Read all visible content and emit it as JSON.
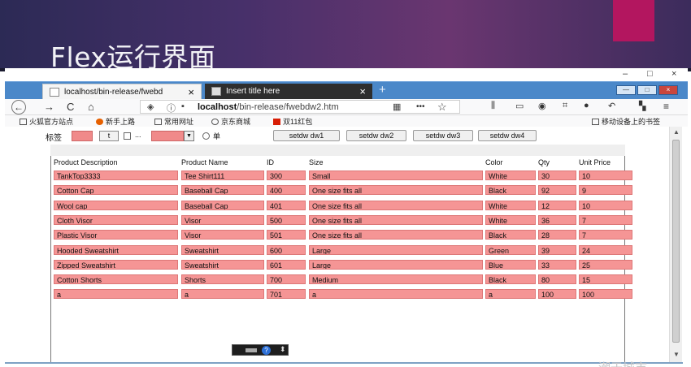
{
  "slide": {
    "title": "Flex运行界面",
    "accent_color": "#b3165f"
  },
  "window": {
    "minimize": "–",
    "maximize": "□",
    "close": "×"
  },
  "tabs": [
    {
      "label": "localhost/bin-release/fwebd",
      "close": "×"
    },
    {
      "label": "Insert title here",
      "close": "×"
    }
  ],
  "newtab": "+",
  "nav": {
    "back": "←",
    "forward": "→",
    "reload": "C",
    "home": "⌂",
    "url_host": "localhost",
    "url_path": "/bin-release/fwebdw2.htm",
    "more": "•••",
    "star": "☆"
  },
  "bookmarks": {
    "items": [
      "火狐官方站点",
      "新手上路",
      "常用网址",
      "京东商城",
      "双11红包"
    ],
    "mobile": "移动设备上的书签"
  },
  "controls": {
    "tag_label": "标签",
    "button_t": "t",
    "check_text": "...",
    "radio_text": "单",
    "dw_buttons": [
      "setdw dw1",
      "setdw dw2",
      "setdw dw3",
      "setdw dw4"
    ]
  },
  "grid": {
    "columns": [
      "Product Description",
      "Product Name",
      "ID",
      "Size",
      "Color",
      "Qty",
      "Unit Price"
    ],
    "rows": [
      [
        "TankTop3333",
        "Tee Shirt111",
        "300",
        "Small",
        "White",
        "30",
        "10"
      ],
      [
        "Cotton Cap",
        "Baseball Cap",
        "400",
        "One size fits all",
        "Black",
        "92",
        "9"
      ],
      [
        "Wool cap",
        "Baseball Cap",
        "401",
        "One size fits all",
        "White",
        "12",
        "10"
      ],
      [
        "Cloth Visor",
        "Visor",
        "500",
        "One size fits all",
        "White",
        "36",
        "7"
      ],
      [
        "Plastic Visor",
        "Visor",
        "501",
        "One size fits all",
        "Black",
        "28",
        "7"
      ],
      [
        "Hooded Sweatshirt",
        "Sweatshirt",
        "600",
        "Large",
        "Green",
        "39",
        "24"
      ],
      [
        "Zipped Sweatshirt",
        "Sweatshirt",
        "601",
        "Large",
        "Blue",
        "33",
        "25"
      ],
      [
        "Cotton Shorts",
        "Shorts",
        "700",
        "Medium",
        "Black",
        "80",
        "15"
      ],
      [
        "a",
        "a",
        "701",
        "a",
        "a",
        "100",
        "100"
      ]
    ]
  },
  "float_tool": {
    "help": "?",
    "spin": "⬍"
  },
  "watermark": "潮于城市"
}
